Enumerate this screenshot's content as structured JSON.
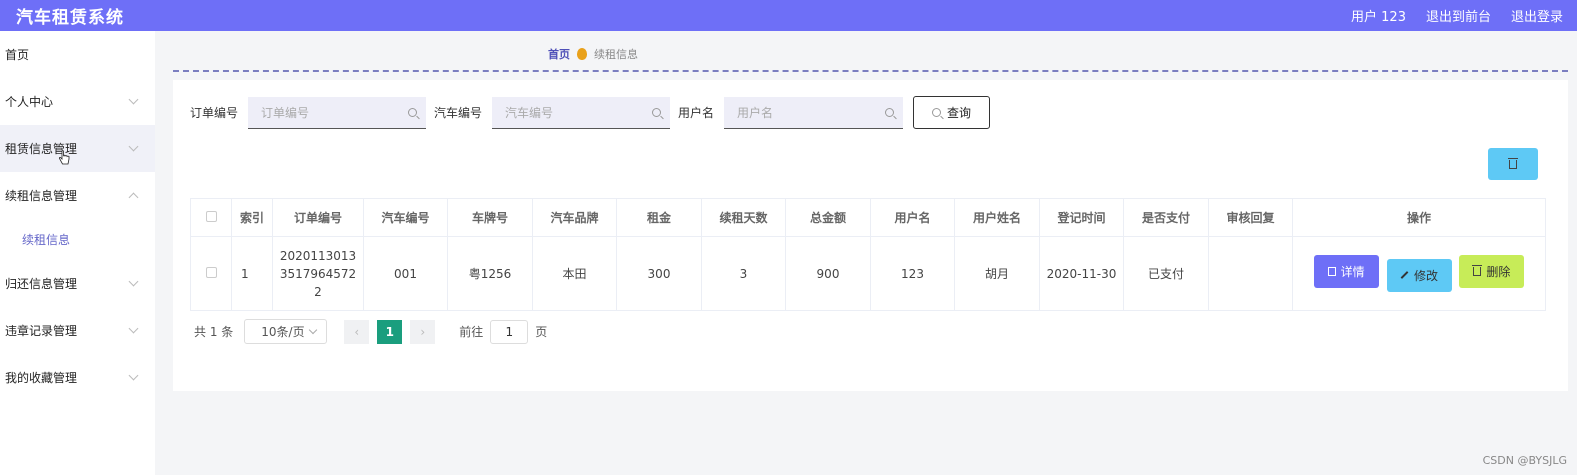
{
  "header": {
    "title": "汽车租赁系统",
    "user": "用户 123",
    "front_link": "退出到前台",
    "logout": "退出登录"
  },
  "sidebar": {
    "items": [
      {
        "label": "首页"
      },
      {
        "label": "个人中心"
      },
      {
        "label": "租赁信息管理"
      },
      {
        "label": "续租信息管理"
      },
      {
        "label": "续租信息"
      },
      {
        "label": "归还信息管理"
      },
      {
        "label": "违章记录管理"
      },
      {
        "label": "我的收藏管理"
      }
    ]
  },
  "breadcrumb": {
    "home": "首页",
    "current": "续租信息"
  },
  "search": {
    "order_label": "订单编号",
    "order_placeholder": "订单编号",
    "car_label": "汽车编号",
    "car_placeholder": "汽车编号",
    "user_label": "用户名",
    "user_placeholder": "用户名",
    "query_button": "查询"
  },
  "table": {
    "headers": [
      "索引",
      "订单编号",
      "汽车编号",
      "车牌号",
      "汽车品牌",
      "租金",
      "续租天数",
      "总金额",
      "用户名",
      "用户姓名",
      "登记时间",
      "是否支付",
      "审核回复",
      "操作"
    ],
    "rows": [
      {
        "index": "1",
        "order_no": "20201130133517964572 2",
        "car_no": "001",
        "plate": "粤1256",
        "brand": "本田",
        "rent": "300",
        "days": "3",
        "total": "900",
        "username": "123",
        "name": "胡月",
        "time": "2020-11-30",
        "paid": "已支付",
        "reply": ""
      }
    ],
    "actions": {
      "detail": "详情",
      "edit": "修改",
      "delete": "删除"
    }
  },
  "pagination": {
    "total": "共 1 条",
    "page_size": "10条/页",
    "current_page": "1",
    "goto_label": "前往",
    "goto_value": "1",
    "page_suffix": "页"
  },
  "watermark": "CSDN @BYSJLG",
  "colors": {
    "primary": "#6e6ff7",
    "info": "#5ec9f5",
    "danger": "#c7ec58",
    "active_page": "#1a9e7e"
  }
}
